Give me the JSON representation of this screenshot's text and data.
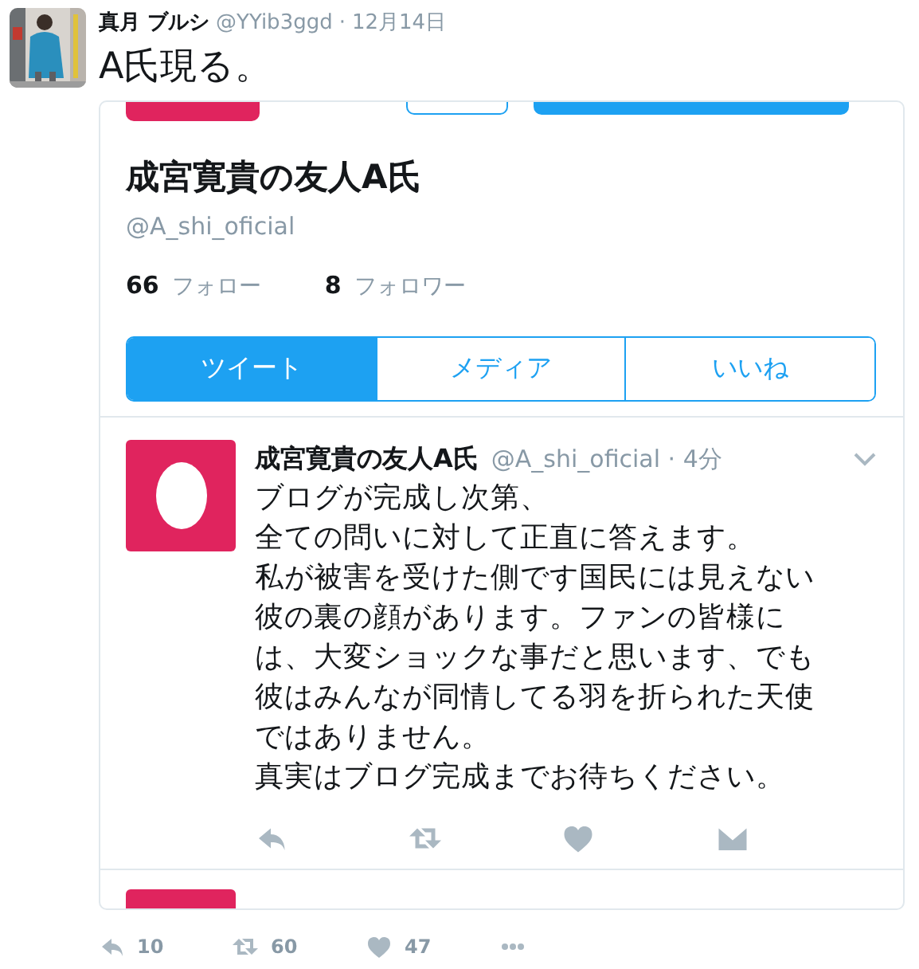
{
  "tweet": {
    "author": "真月 ブルシ",
    "handle": "@YYib3ggd",
    "separator": "·",
    "date": "12月14日",
    "text": "A氏現る。",
    "embedded_screenshot": {
      "profile": {
        "name": "成宮寛貴の友人A氏",
        "handle": "@A_shi_oficial",
        "stats": [
          {
            "count": "66",
            "label": "フォロー"
          },
          {
            "count": "8",
            "label": "フォロワー"
          }
        ],
        "tabs": [
          {
            "label": "ツイート",
            "selected": true
          },
          {
            "label": "メディア",
            "selected": false
          },
          {
            "label": "いいね",
            "selected": false
          }
        ]
      },
      "tweets": [
        {
          "name": "成宮寛貴の友人A氏",
          "handle": "@A_shi_oficial",
          "time": "· 4分",
          "lines": [
            "ブログが完成し次第、",
            "全ての問いに対して正直に答えます。",
            "私が被害を受けた側です国民には見えない",
            "彼の裏の顔があります。ファンの皆様に",
            "は、大変ショックな事だと思います、でも",
            "彼はみんなが同情してる羽を折られた天使",
            "ではありません。",
            "真実はブログ完成までお待ちください。"
          ]
        }
      ]
    },
    "actions": [
      {
        "kind": "reply",
        "count": "10"
      },
      {
        "kind": "retweet",
        "count": "60"
      },
      {
        "kind": "like",
        "count": "47"
      },
      {
        "kind": "more"
      }
    ]
  }
}
